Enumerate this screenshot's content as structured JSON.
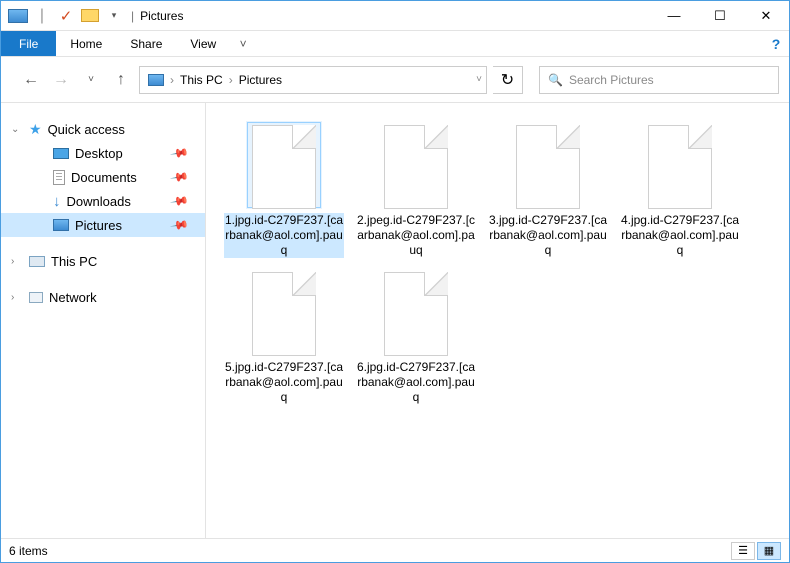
{
  "titlebar": {
    "title": "Pictures",
    "separator": "|"
  },
  "winbuttons": {
    "min": "—",
    "max": "☐",
    "close": "✕"
  },
  "ribbon": {
    "file": "File",
    "tabs": [
      "Home",
      "Share",
      "View"
    ],
    "expand": "˅",
    "help": "?"
  },
  "nav": {
    "back": "←",
    "forward": "→",
    "recent": "˅",
    "up": "↑",
    "crumbs": [
      "This PC",
      "Pictures"
    ],
    "sep": "›",
    "dropdown": "˅",
    "refresh": "↻"
  },
  "search": {
    "placeholder": "Search Pictures",
    "icon": "🔍"
  },
  "sidebar": {
    "quickaccess": "Quick access",
    "items": [
      {
        "label": "Desktop",
        "icon": "desktop",
        "pinned": true
      },
      {
        "label": "Documents",
        "icon": "doc",
        "pinned": true
      },
      {
        "label": "Downloads",
        "icon": "dl",
        "pinned": true
      },
      {
        "label": "Pictures",
        "icon": "pic",
        "pinned": true,
        "selected": true
      }
    ],
    "thispc": "This PC",
    "network": "Network"
  },
  "files": [
    {
      "name": "1.jpg.id-C279F237.[carbanak@aol.com].pauq",
      "selected": true
    },
    {
      "name": "2.jpeg.id-C279F237.[carbanak@aol.com].pauq"
    },
    {
      "name": "3.jpg.id-C279F237.[carbanak@aol.com].pauq"
    },
    {
      "name": "4.jpg.id-C279F237.[carbanak@aol.com].pauq"
    },
    {
      "name": "5.jpg.id-C279F237.[carbanak@aol.com].pauq"
    },
    {
      "name": "6.jpg.id-C279F237.[carbanak@aol.com].pauq"
    }
  ],
  "status": {
    "count": "6 items"
  }
}
